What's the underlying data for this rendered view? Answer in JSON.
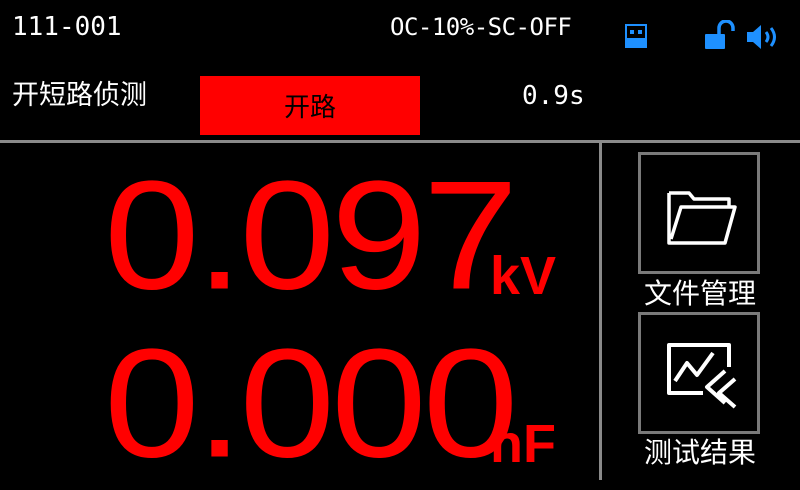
{
  "status_bar": {
    "file_id": "111-001",
    "mode_status": "OC-10%-SC-OFF",
    "icons": [
      "usb-storage-icon",
      "unlocked-icon",
      "speaker-icon"
    ],
    "icon_color": "#1e90ff"
  },
  "detection": {
    "label": "开短路侦测",
    "state": "开路",
    "state_color": "#ff0000",
    "time": "0.9s"
  },
  "readings": {
    "voltage": {
      "value": "0.097",
      "unit": "kV"
    },
    "capacitance": {
      "value": "0.000",
      "unit": "nF"
    },
    "color": "#ff0000"
  },
  "side_menu": {
    "file_manage": {
      "label": "文件管理",
      "icon": "folder-icon"
    },
    "test_results": {
      "label": "测试结果",
      "icon": "chart-return-icon"
    }
  }
}
